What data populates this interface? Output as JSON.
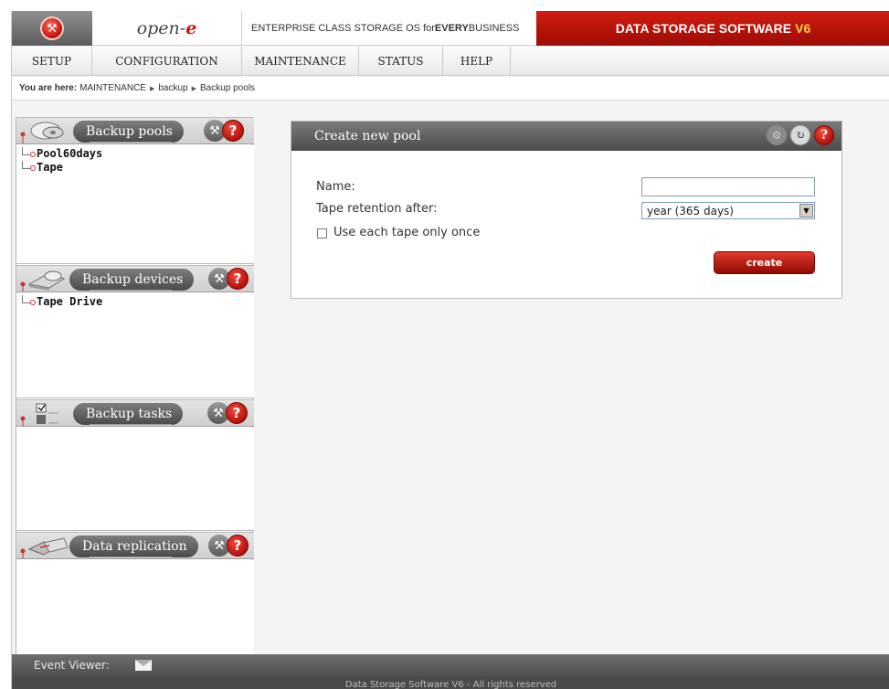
{
  "header": {
    "brand_text": "open-",
    "brand_e": "e",
    "tagline_prefix": "ENTERPRISE CLASS STORAGE OS for ",
    "tagline_bold": "EVERY",
    "tagline_suffix": " BUSINESS",
    "product": "DATA STORAGE SOFTWARE",
    "product_version": "V6",
    "logo_icon": "wrench-badge-icon"
  },
  "nav": {
    "items": [
      "SETUP",
      "CONFIGURATION",
      "MAINTENANCE",
      "STATUS",
      "HELP"
    ]
  },
  "breadcrumb": {
    "label": "You are here:",
    "path": [
      "MAINTENANCE",
      "backup",
      "Backup pools"
    ]
  },
  "sidebar": {
    "sections": [
      {
        "title": "Backup pools",
        "icon": "tape-disks-icon",
        "items": [
          "Pool60days",
          "Tape"
        ]
      },
      {
        "title": "Backup devices",
        "icon": "tape-drive-icon",
        "items": [
          "Tape Drive"
        ]
      },
      {
        "title": "Backup tasks",
        "icon": "task-checklist-icon",
        "items": []
      },
      {
        "title": "Data replication",
        "icon": "replication-icon",
        "items": []
      }
    ]
  },
  "panel": {
    "title": "Create new pool",
    "name_label": "Name:",
    "name_value": "",
    "retention_label": "Tape retention after:",
    "retention_value": "year (365 days)",
    "checkbox_label": "Use each tape only once",
    "checkbox_checked": false,
    "create_label": "create"
  },
  "footer": {
    "event_viewer": "Event Viewer:",
    "copyright": "Data Storage Software V6 - All rights reserved"
  }
}
